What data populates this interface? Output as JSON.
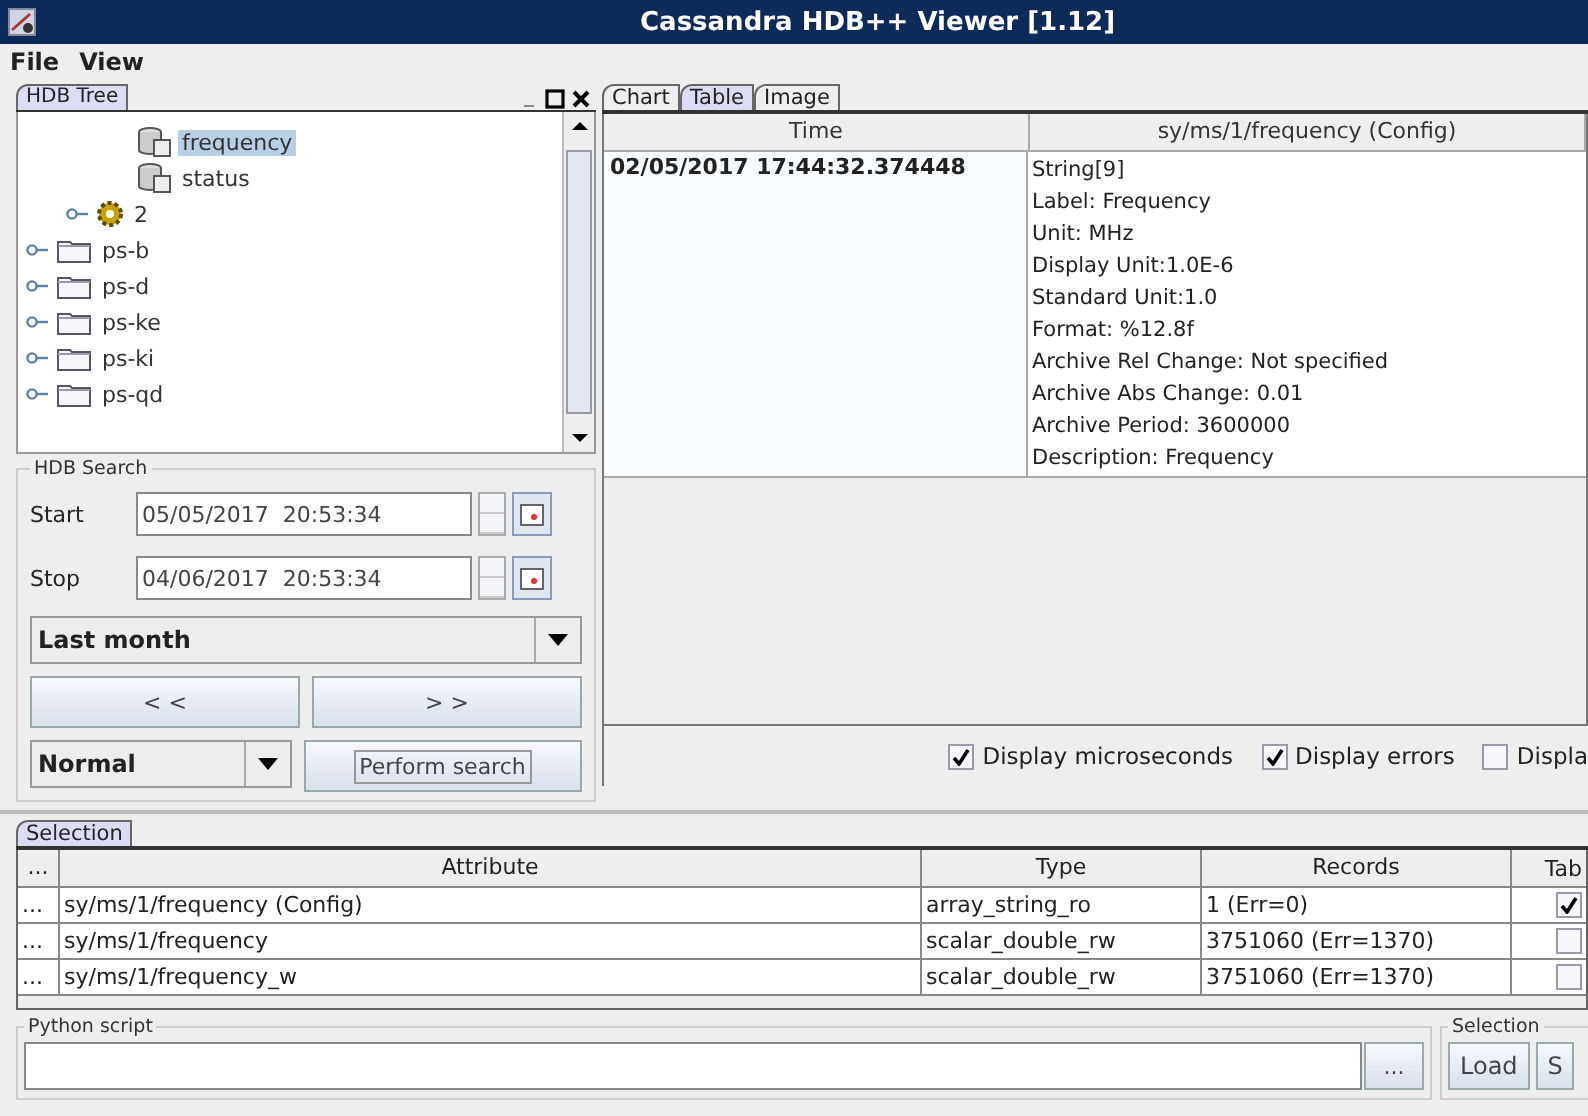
{
  "window": {
    "title": "Cassandra HDB++ Viewer [1.12]"
  },
  "menu": [
    "File",
    "View"
  ],
  "tree_panel": {
    "tab": "HDB Tree",
    "items": [
      {
        "children": [
          {
            "children": [
              {
                "label": "frequency",
                "kind": "attribute",
                "selected": true
              },
              {
                "label": "status",
                "kind": "attribute",
                "selected": false
              }
            ]
          },
          {
            "label": "2",
            "kind": "device",
            "selected": false
          }
        ]
      },
      {
        "label": "ps-b",
        "kind": "folder",
        "selected": false
      },
      {
        "label": "ps-d",
        "kind": "folder",
        "selected": false
      },
      {
        "label": "ps-ke",
        "kind": "folder",
        "selected": false
      },
      {
        "label": "ps-ki",
        "kind": "folder",
        "selected": false
      },
      {
        "label": "ps-qd",
        "kind": "folder",
        "selected": false
      }
    ]
  },
  "search": {
    "title": "HDB Search",
    "start_label": "Start",
    "start": "05/05/2017  20:53:34",
    "stop_label": "Stop",
    "stop": "04/06/2017  20:53:34",
    "range": "Last month",
    "prev": "< <",
    "next": "> >",
    "mode": "Normal",
    "perform": "Perform search"
  },
  "view_tabs": [
    {
      "label": "Chart",
      "selected": false
    },
    {
      "label": "Table",
      "selected": true
    },
    {
      "label": "Image",
      "selected": false
    }
  ],
  "data_table": {
    "columns": [
      "Time",
      "sy/ms/1/frequency (Config)"
    ],
    "rows": [
      {
        "time": "02/05/2017 17:44:32.374448",
        "lines": [
          "String[9]",
          "Label: Frequency",
          "Unit: MHz",
          "Display Unit:1.0E-6",
          "Standard Unit:1.0",
          "Format: %12.8f",
          "Archive Rel Change: Not specified",
          "Archive Abs Change: 0.01",
          "Archive Period: 3600000",
          "Description: Frequency"
        ]
      }
    ]
  },
  "options": [
    {
      "label": "Display microseconds",
      "checked": true
    },
    {
      "label": "Display errors",
      "checked": true
    },
    {
      "label": "Displa",
      "checked": false
    }
  ],
  "selection": {
    "tab": "Selection",
    "columns": [
      "...",
      "Attribute",
      "Type",
      "Records",
      "Tab"
    ],
    "rows": [
      {
        "handle": "...",
        "attribute": "sy/ms/1/frequency (Config)",
        "type": "array_string_ro",
        "records": "1 (Err=0)",
        "checked": true
      },
      {
        "handle": "...",
        "attribute": "sy/ms/1/frequency",
        "type": "scalar_double_rw",
        "records": "3751060 (Err=1370)",
        "checked": false
      },
      {
        "handle": "...",
        "attribute": "sy/ms/1/frequency_w",
        "type": "scalar_double_rw",
        "records": "3751060 (Err=1370)",
        "checked": false
      }
    ]
  },
  "python": {
    "title": "Python script",
    "browse": "..."
  },
  "selection_box": {
    "title": "Selection",
    "buttons": [
      "Load",
      "S"
    ]
  }
}
